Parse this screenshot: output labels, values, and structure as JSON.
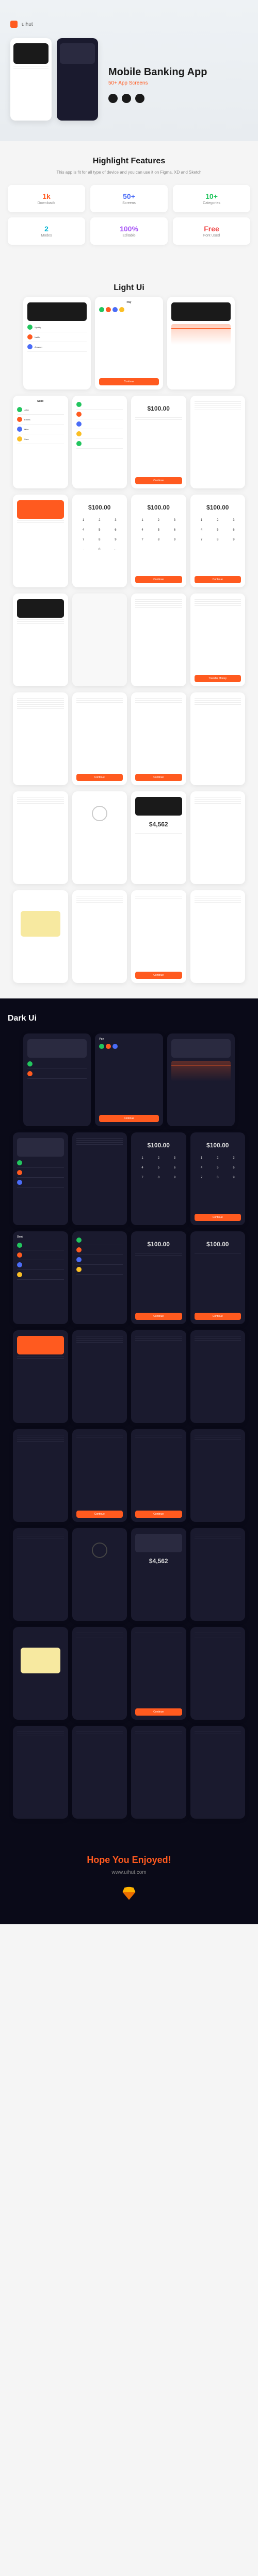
{
  "hero": {
    "logo": "uihut",
    "title": "Mobile Banking App",
    "subtitle": "50+ App Screens"
  },
  "highlight": {
    "title": "Highlight Features",
    "desc": "This app is fit for all type of device and you can use it on Figma, XD and Sketch"
  },
  "features": [
    {
      "num": "1k",
      "label": "Downloads",
      "cls": "c-orange"
    },
    {
      "num": "50+",
      "label": "Screens",
      "cls": "c-blue"
    },
    {
      "num": "10+",
      "label": "Categories",
      "cls": "c-green"
    },
    {
      "num": "2",
      "label": "Modes",
      "cls": "c-teal"
    },
    {
      "num": "100%",
      "label": "Editable",
      "cls": "c-purple"
    },
    {
      "num": "Free",
      "label": "Font Used",
      "cls": "c-red"
    }
  ],
  "light": {
    "title": "Light Ui"
  },
  "dark": {
    "title": "Dark Ui"
  },
  "footer": {
    "title": "Hope You Enjoyed!",
    "url": "www.uihut.com"
  },
  "screens": {
    "balance": "$4,562",
    "amount": "$100.00",
    "pay": "Pay",
    "send": "Send",
    "continue": "Continue",
    "transfer": "Transfer Money",
    "txlist": [
      "Spotify",
      "Netflix",
      "Amazon",
      "Apple"
    ],
    "contacts": [
      "John",
      "Emma",
      "Mike",
      "Sara"
    ]
  }
}
